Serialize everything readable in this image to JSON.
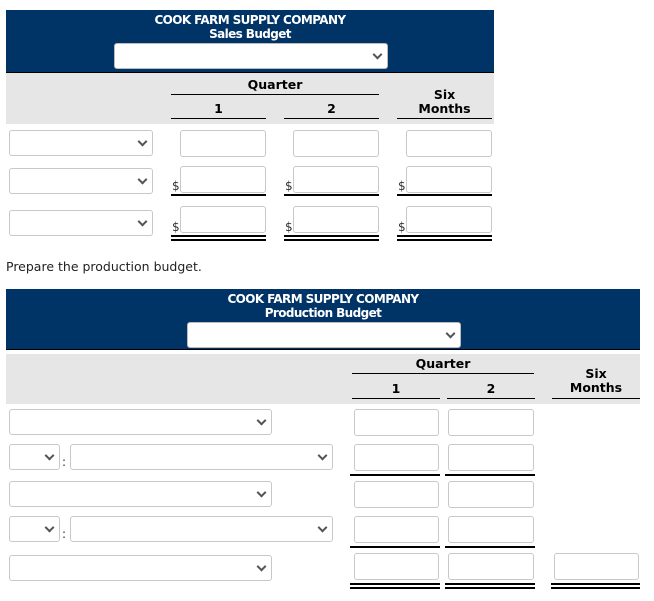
{
  "sales_budget": {
    "company": "COOK FARM SUPPLY COMPANY",
    "title": "Sales Budget",
    "period_select": {
      "value": ""
    },
    "columns": {
      "group": "Quarter",
      "q1": "1",
      "q2": "2",
      "total": "Six\nMonths"
    },
    "rows": [
      {
        "label_select": "",
        "currency": "",
        "q1": "",
        "q2": "",
        "total": ""
      },
      {
        "label_select": "",
        "currency": "$",
        "q1": "",
        "q2": "",
        "total": ""
      },
      {
        "label_select": "",
        "currency": "$",
        "q1": "",
        "q2": "",
        "total": ""
      }
    ]
  },
  "instruction": "Prepare the production budget.",
  "production_budget": {
    "company": "COOK FARM SUPPLY COMPANY",
    "title": "Production Budget",
    "period_select": {
      "value": ""
    },
    "columns": {
      "group": "Quarter",
      "q1": "1",
      "q2": "2",
      "total": "Six\nMonths"
    },
    "colon": ":",
    "rows": [
      {
        "type": "single",
        "label_select": "",
        "q1": "",
        "q2": ""
      },
      {
        "type": "double",
        "op_select": "",
        "label_select": "",
        "q1": "",
        "q2": ""
      },
      {
        "type": "single",
        "label_select": "",
        "q1": "",
        "q2": ""
      },
      {
        "type": "double",
        "op_select": "",
        "label_select": "",
        "q1": "",
        "q2": ""
      },
      {
        "type": "single",
        "label_select": "",
        "q1": "",
        "q2": "",
        "total": ""
      }
    ]
  }
}
